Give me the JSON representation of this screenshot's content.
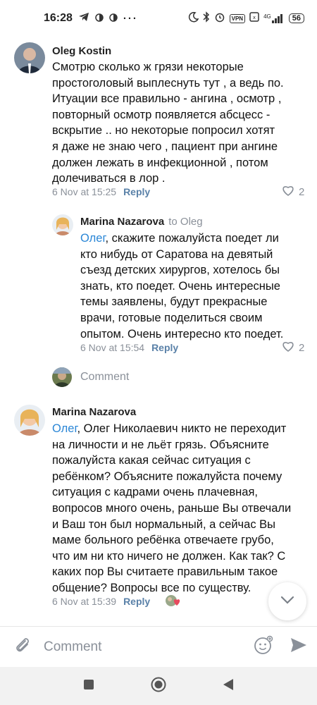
{
  "status_bar": {
    "time": "16:28",
    "vpn": "VPN",
    "net": "4G",
    "battery": "56"
  },
  "comments": [
    {
      "author": "Oleg Kostin",
      "lines": [
        "Смотрю сколько ж грязи некоторые",
        "простоголовый выплеснуть тут , а ведь по.",
        "Итуации все правильно - ангина , осмотр ,",
        "повторный осмотр появляется абсцесс -",
        "вскрытие .. но некоторые попросил хотят",
        "я даже не знаю чего , пациент при ангине",
        "должен лежать в инфекционной , потом",
        "долечиваться в лор ."
      ],
      "timestamp": "6 Nov at 15:25",
      "reply_label": "Reply",
      "likes": "2"
    },
    {
      "author": "Marina Nazarova",
      "to": "to Oleg",
      "mention": "Олег",
      "lines": [
        ", скажите пожалуйста поедет ли",
        "кто нибудь от Саратова на девятый",
        "съезд детских хирургов, хотелось бы",
        "знать, кто поедет. Очень интересные",
        "темы заявлены, будут прекрасные",
        "врачи, готовые поделиться своим",
        "опытом. Очень интересно кто поедет."
      ],
      "timestamp": "6 Nov at 15:54",
      "reply_label": "Reply",
      "likes": "2"
    },
    {
      "author": "Marina Nazarova",
      "mention": "Олег",
      "lines": [
        ", Олег Николаевич никто не переходит",
        "на личности и не льёт грязь. Объясните",
        "пожалуйста какая сейчас ситуация с",
        "ребёнком? Объясните пожалуйста почему",
        "ситуация с кадрами очень плачевная,",
        "вопросов много очень, раньше Вы отвечали",
        "и Ваш тон был нормальный, а сейчас Вы",
        "маме больного ребёнка отвечаете грубо,",
        "что им ни  кто ничего не должен. Как так? С",
        "каких пор Вы считаете правильным такое",
        "общение? Вопросы все по существу."
      ],
      "timestamp": "6 Nov at 15:39",
      "reply_label": "Reply"
    }
  ],
  "write_comment": {
    "label": "Comment"
  },
  "composer": {
    "placeholder": "Comment"
  },
  "colors": {
    "accent": "#2a86d6",
    "meta": "#8a9099",
    "reply": "#5a81a8"
  },
  "icons": [
    "telegram-icon",
    "moon-icon",
    "bluetooth-icon",
    "alarm-icon",
    "heart-icon",
    "chevron-down-icon",
    "attach-icon",
    "emoji-icon",
    "send-icon"
  ]
}
